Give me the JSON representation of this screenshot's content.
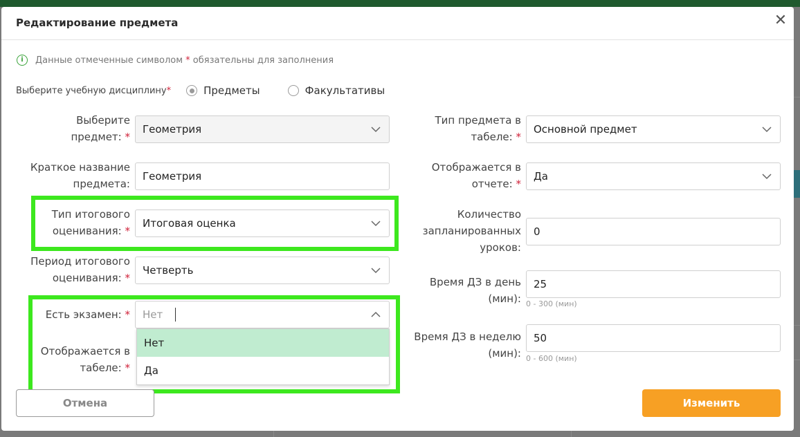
{
  "modal": {
    "title": "Редактирование предмета",
    "close_glyph": "✕",
    "notice_icon": "info-icon",
    "notice_before": "Данные отмеченные символом ",
    "notice_star": "*",
    "notice_after": " обязательны для заполнения",
    "required_mark": "*"
  },
  "discipline": {
    "label": "Выберите учебную дисциплину",
    "options": [
      {
        "label": "Предметы",
        "checked": true
      },
      {
        "label": "Факультативы",
        "checked": false
      }
    ]
  },
  "left": {
    "subject": {
      "label_line1": "Выберите",
      "label_line2": "предмет:",
      "value": "Геометрия"
    },
    "short_name": {
      "label_line1": "Краткое название",
      "label_line2": "предмета:",
      "value": "Геометрия"
    },
    "grade_type": {
      "label_line1": "Тип итогового",
      "label_line2": "оценивания:",
      "value": "Итоговая оценка"
    },
    "grade_period": {
      "label_line1": "Период итогового",
      "label_line2": "оценивания:",
      "value": "Четверть"
    },
    "exam": {
      "label": "Есть экзамен:",
      "value": "Нет"
    },
    "in_register": {
      "label_line1": "Отображается в",
      "label_line2": "табеле:"
    }
  },
  "exam_dropdown": {
    "options": [
      {
        "label": "Нет",
        "selected": true
      },
      {
        "label": "Да",
        "selected": false
      }
    ]
  },
  "right": {
    "subject_type": {
      "label_line1": "Тип предмета в",
      "label_line2": "табеле:",
      "value": "Основной предмет"
    },
    "in_report": {
      "label_line1": "Отображается в",
      "label_line2": "отчете:",
      "value": "Да"
    },
    "lessons": {
      "label_line1": "Количество",
      "label_line2": "запланированных",
      "label_line3": "уроков:",
      "value": "0"
    },
    "hw_day": {
      "label_line1": "Время ДЗ в день",
      "label_line2": "(мин):",
      "value": "25",
      "hint": "0 - 300 (мин)"
    },
    "hw_week": {
      "label_line1": "Время ДЗ в неделю",
      "label_line2": "(мин):",
      "value": "50",
      "hint": "0 - 600 (мин)"
    }
  },
  "buttons": {
    "cancel": "Отмена",
    "submit": "Изменить"
  },
  "colors": {
    "accent": "#f7a024",
    "highlight": "#3de81e",
    "selected_option": "#c0ecd0",
    "required": "#d0223a"
  }
}
